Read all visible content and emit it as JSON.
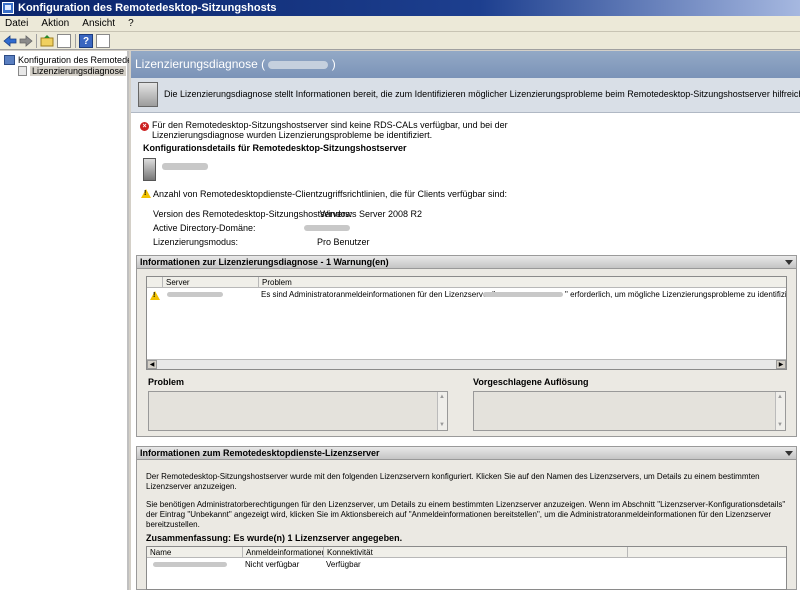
{
  "window": {
    "title": "Konfiguration des Remotedesktop-Sitzungshosts"
  },
  "menu": [
    "Datei",
    "Aktion",
    "Ansicht",
    "?"
  ],
  "tree": {
    "root": "Konfiguration des Remotedesktop",
    "child": "Lizenzierungsdiagnose"
  },
  "header": {
    "title": "Lizenzierungsdiagnose ("
  },
  "intro": "Die Lizenzierungsdiagnose stellt Informationen bereit, die zum Identifizieren möglicher Lizenzierungsprobleme beim Remotedesktop-Sitzungshostserver hilfreich sind.",
  "error_message": "Für den Remotedesktop-Sitzungshostserver sind keine RDS-CALs verfügbar, und bei der Lizenzierungsdiagnose wurden Lizenzierungsprobleme be identifiziert.",
  "config_heading": "Konfigurationsdetails für Remotedesktop-Sitzungshostserver",
  "warning_line": "Anzahl von Remotedesktopdienste-Clientzugriffsrichtlinien, die für Clients verfügbar sind:",
  "details": [
    {
      "label": "Version des Remotedesktop-Sitzungshostservers:",
      "value": "Windows Server 2008 R2"
    },
    {
      "label": "Active Directory-Domäne:",
      "value": ""
    },
    {
      "label": "Lizenzierungsmodus:",
      "value": "Pro Benutzer"
    }
  ],
  "diag_section": {
    "title": "Informationen zur Lizenzierungsdiagnose - 1 Warnung(en)",
    "columns": [
      "Server",
      "Problem"
    ],
    "row_problem_prefix": "Es sind Administratoranmeldeinformationen für den Lizenzserver \"",
    "row_problem_suffix": "\" erforderlich, um mögliche Lizenzierungsprobleme zu identifizieren.",
    "problem_label": "Problem",
    "resolution_label": "Vorgeschlagene Auflösung"
  },
  "ls_section": {
    "title": "Informationen zum Remotedesktopdienste-Lizenzserver",
    "para1": "Der Remotedesktop-Sitzungshostserver wurde mit den folgenden Lizenzservern konfiguriert. Klicken Sie auf den Namen des Lizenzservers, um Details zu einem bestimmten Lizenzserver anzuzeigen.",
    "para2": "Sie benötigen Administratorberechtigungen für den Lizenzserver, um Details zu einem bestimmten Lizenzserver anzuzeigen. Wenn im Abschnitt \"Lizenzserver-Konfigurationsdetails\" der Eintrag \"Unbekannt\" angezeigt wird, klicken Sie im Aktionsbereich auf \"Anmeldeinformationen bereitstellen\", um die Administratoranmeldeinformationen für den Lizenzserver bereitzustellen.",
    "summary": "Zusammenfassung: Es wurde(n) 1 Lizenzserver angegeben.",
    "columns": [
      "Name",
      "Anmeldeinformationen",
      "Konnektivität"
    ],
    "row": {
      "credentials": "Nicht verfügbar",
      "connectivity": "Verfügbar"
    }
  },
  "icons": [
    "back-arrow-icon",
    "forward-arrow-icon",
    "up-folder-icon",
    "console-tree-icon",
    "help-icon",
    "mmc-icon",
    "error-icon",
    "warning-icon",
    "server-icon"
  ]
}
